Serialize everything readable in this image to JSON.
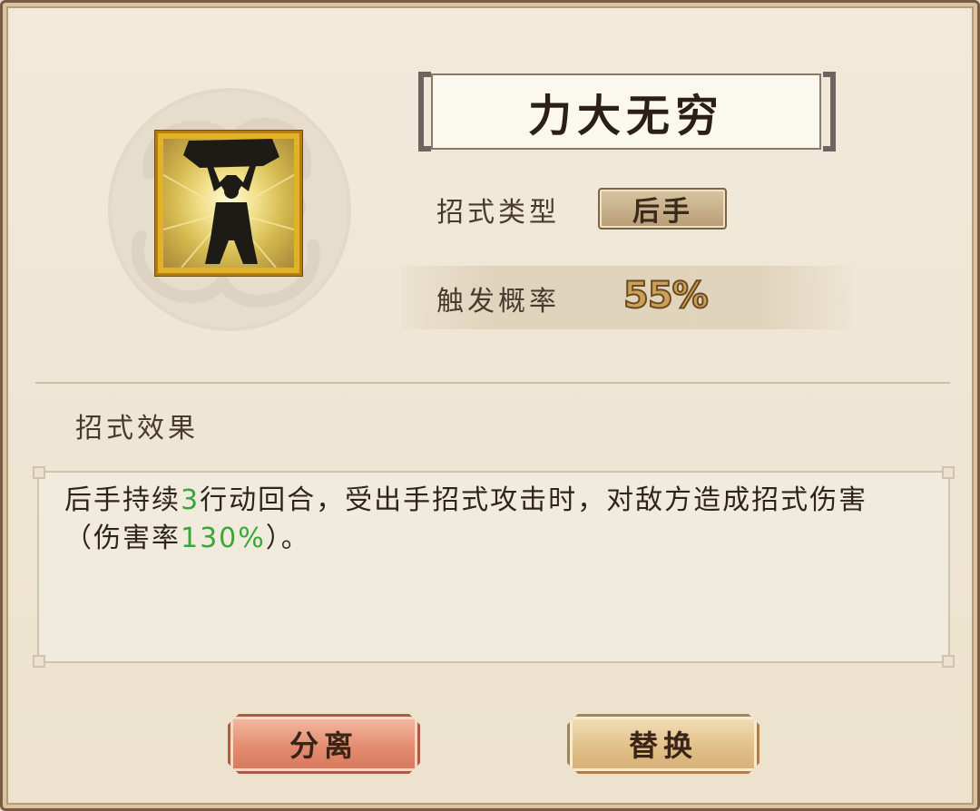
{
  "skill": {
    "name": "力大无穷",
    "icon": "strongman-lifting-boulder-icon"
  },
  "attributes": {
    "type_label": "招式类型",
    "type_value": "后手",
    "rate_label": "触发概率",
    "rate_value": "55%"
  },
  "effect": {
    "title": "招式效果",
    "text_1": "后手持续",
    "duration": "3",
    "text_2": "行动回合，受出手招式攻击时，对敌方造成招式伤害（伤害率",
    "damage_rate": "130%",
    "text_3": "）。"
  },
  "buttons": {
    "split_label": "分离",
    "replace_label": "替换"
  },
  "colors": {
    "highlight_green": "#39a63a",
    "icon_gold": "#e3b128",
    "split_button": "#e48c70",
    "replace_button": "#e2c08a"
  }
}
